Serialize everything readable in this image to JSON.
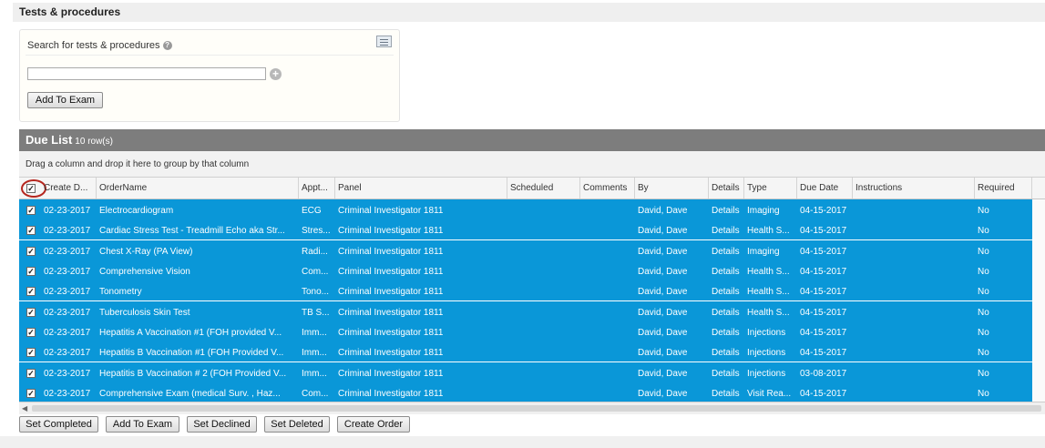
{
  "section": {
    "title": "Tests & procedures"
  },
  "search": {
    "label": "Search for tests & procedures",
    "help_glyph": "?",
    "input_value": "",
    "add_glyph": "+",
    "add_to_exam_label": "Add To Exam"
  },
  "duelist": {
    "title": "Due List",
    "row_count": "10 row(s)",
    "group_hint": "Drag a column and drop it here to group by that column",
    "columns": [
      "Create D...",
      "OrderName",
      "Appt...",
      "Panel",
      "Scheduled",
      "Comments",
      "By",
      "Details",
      "Type",
      "Due Date",
      "Instructions",
      "Required"
    ],
    "header_checkbox_checked": true,
    "rows": [
      {
        "checked": true,
        "create_date": "02-23-2017",
        "order_name": "Electrocardiogram",
        "appt": "ECG",
        "panel": "Criminal Investigator 1811",
        "scheduled": "",
        "comments": "",
        "by": "David, Dave",
        "details": "Details",
        "type": "Imaging",
        "due_date": "04-15-2017",
        "instructions": "",
        "required": "No"
      },
      {
        "checked": true,
        "create_date": "02-23-2017",
        "order_name": "Cardiac Stress Test - Treadmill Echo aka Str...",
        "appt": "Stres...",
        "panel": "Criminal Investigator 1811",
        "scheduled": "",
        "comments": "",
        "by": "David, Dave",
        "details": "Details",
        "type": "Health S...",
        "due_date": "04-15-2017",
        "instructions": "",
        "required": "No"
      },
      {
        "checked": true,
        "create_date": "02-23-2017",
        "order_name": "Chest X-Ray (PA View)",
        "appt": "Radi...",
        "panel": "Criminal Investigator 1811",
        "scheduled": "",
        "comments": "",
        "by": "David, Dave",
        "details": "Details",
        "type": "Imaging",
        "due_date": "04-15-2017",
        "instructions": "",
        "required": "No"
      },
      {
        "checked": true,
        "create_date": "02-23-2017",
        "order_name": "Comprehensive Vision",
        "appt": "Com...",
        "panel": "Criminal Investigator 1811",
        "scheduled": "",
        "comments": "",
        "by": "David, Dave",
        "details": "Details",
        "type": "Health S...",
        "due_date": "04-15-2017",
        "instructions": "",
        "required": "No"
      },
      {
        "checked": true,
        "create_date": "02-23-2017",
        "order_name": "Tonometry",
        "appt": "Tono...",
        "panel": "Criminal Investigator 1811",
        "scheduled": "",
        "comments": "",
        "by": "David, Dave",
        "details": "Details",
        "type": "Health S...",
        "due_date": "04-15-2017",
        "instructions": "",
        "required": "No"
      },
      {
        "checked": true,
        "create_date": "02-23-2017",
        "order_name": "Tuberculosis Skin Test",
        "appt": "TB S...",
        "panel": "Criminal Investigator 1811",
        "scheduled": "",
        "comments": "",
        "by": "David, Dave",
        "details": "Details",
        "type": "Health S...",
        "due_date": "04-15-2017",
        "instructions": "",
        "required": "No"
      },
      {
        "checked": true,
        "create_date": "02-23-2017",
        "order_name": "Hepatitis A Vaccination #1 (FOH provided V...",
        "appt": "Imm...",
        "panel": "Criminal Investigator 1811",
        "scheduled": "",
        "comments": "",
        "by": "David, Dave",
        "details": "Details",
        "type": "Injections",
        "due_date": "04-15-2017",
        "instructions": "",
        "required": "No"
      },
      {
        "checked": true,
        "create_date": "02-23-2017",
        "order_name": "Hepatitis B Vaccination #1 (FOH Provided V...",
        "appt": "Imm...",
        "panel": "Criminal Investigator 1811",
        "scheduled": "",
        "comments": "",
        "by": "David, Dave",
        "details": "Details",
        "type": "Injections",
        "due_date": "04-15-2017",
        "instructions": "",
        "required": "No"
      },
      {
        "checked": true,
        "create_date": "02-23-2017",
        "order_name": "Hepatitis B Vaccination # 2 (FOH Provided V...",
        "appt": "Imm...",
        "panel": "Criminal Investigator 1811",
        "scheduled": "",
        "comments": "",
        "by": "David, Dave",
        "details": "Details",
        "type": "Injections",
        "due_date": "03-08-2017",
        "instructions": "",
        "required": "No"
      },
      {
        "checked": true,
        "create_date": "02-23-2017",
        "order_name": "Comprehensive Exam (medical Surv. , Haz...",
        "appt": "Com...",
        "panel": "Criminal Investigator 1811",
        "scheduled": "",
        "comments": "",
        "by": "David, Dave",
        "details": "Details",
        "type": "Visit Rea...",
        "due_date": "04-15-2017",
        "instructions": "",
        "required": "No"
      }
    ]
  },
  "actions": {
    "set_completed": "Set Completed",
    "add_to_exam": "Add To Exam",
    "set_declined": "Set Declined",
    "set_deleted": "Set Deleted",
    "create_order": "Create Order"
  },
  "colors": {
    "row_selected": "#0a97d8",
    "header_bar": "#7d7d7d",
    "highlight_ring": "#b5261e"
  }
}
